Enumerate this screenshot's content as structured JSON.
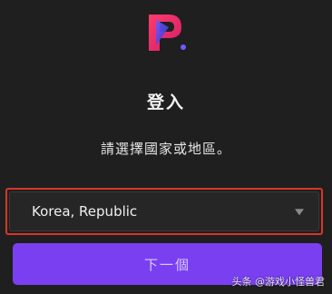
{
  "login": {
    "title": "登入",
    "subtitle": "請選擇國家或地區。",
    "country_select": {
      "value": "Korea, Republic"
    },
    "next_button": "下一個"
  },
  "watermark": "头条 @游戏小怪兽君",
  "colors": {
    "background": "#1f1f1f",
    "accent": "#7b3ff2",
    "highlight_border": "#d9352b"
  },
  "icons": {
    "logo": "brand-logo-icon",
    "dropdown": "caret-down-icon"
  }
}
